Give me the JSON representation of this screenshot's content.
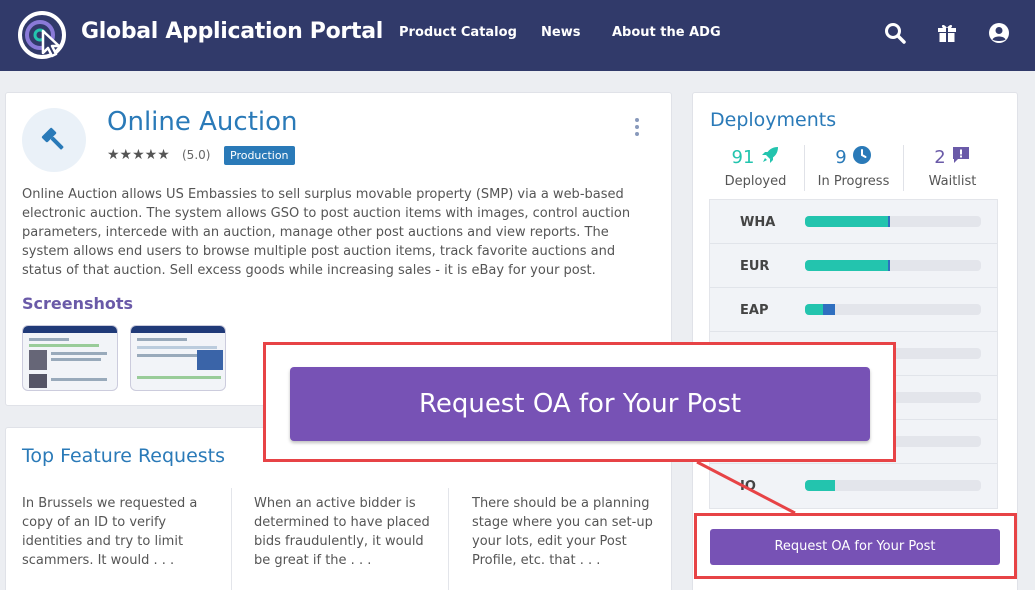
{
  "header": {
    "brand": "Global Application Portal",
    "nav": [
      "Product Catalog",
      "News",
      "About the ADG"
    ],
    "icons": [
      "search-icon",
      "gift-box-icon",
      "user-icon"
    ]
  },
  "app": {
    "title": "Online Auction",
    "stars": "★★★★★",
    "rating": "(5.0)",
    "status": "Production",
    "description": "Online Auction allows US Embassies to sell surplus movable property (SMP) via a web-based electronic auction. The system allows GSO to post auction items with images, control auction parameters, intercede with an auction, manage other post auctions and view reports. The system allows end users to browse multiple post auction items, track favorite auctions and status of that auction. Sell excess goods while increasing sales - it is eBay for your post.",
    "screenshots_heading": "Screenshots"
  },
  "features": {
    "title": "Top Feature Requests",
    "items": [
      "In Brussels we requested a copy of an ID to verify identities and try to limit scammers. It would . . .",
      "When an active bidder is determined to have placed bids fraudulently, it would be great if the . . .",
      "There should be a planning stage where you can set-up your lots, edit your Post Profile, etc. that . . ."
    ]
  },
  "deployments": {
    "title": "Deployments",
    "stats": [
      {
        "value": "91",
        "label": "Deployed",
        "color": "#23c4ae",
        "icon": "rocket-icon"
      },
      {
        "value": "9",
        "label": "In Progress",
        "color": "#2a7ab8",
        "icon": "clock-icon"
      },
      {
        "value": "2",
        "label": "Waitlist",
        "color": "#6a5aa8",
        "icon": "waitlist-icon"
      }
    ],
    "regions": [
      {
        "name": "WHA",
        "deployed": 0.47,
        "progress": 0.015
      },
      {
        "name": "EUR",
        "deployed": 0.47,
        "progress": 0.015
      },
      {
        "name": "EAP",
        "deployed": 0.1,
        "progress": 0.07
      },
      {
        "name": "",
        "deployed": 0,
        "progress": 0
      },
      {
        "name": "",
        "deployed": 0,
        "progress": 0
      },
      {
        "name": "",
        "deployed": 0,
        "progress": 0
      },
      {
        "name": "IO",
        "deployed": 0.17,
        "progress": 0
      }
    ],
    "request_button": "Request OA for Your Post"
  },
  "callout": {
    "button": "Request OA for Your Post"
  },
  "colors": {
    "navbar": "#313a6a",
    "accent_blue": "#2a7ab8",
    "purple": "#7752b5",
    "teal": "#23c4ae",
    "highlight_red": "#e74346"
  }
}
